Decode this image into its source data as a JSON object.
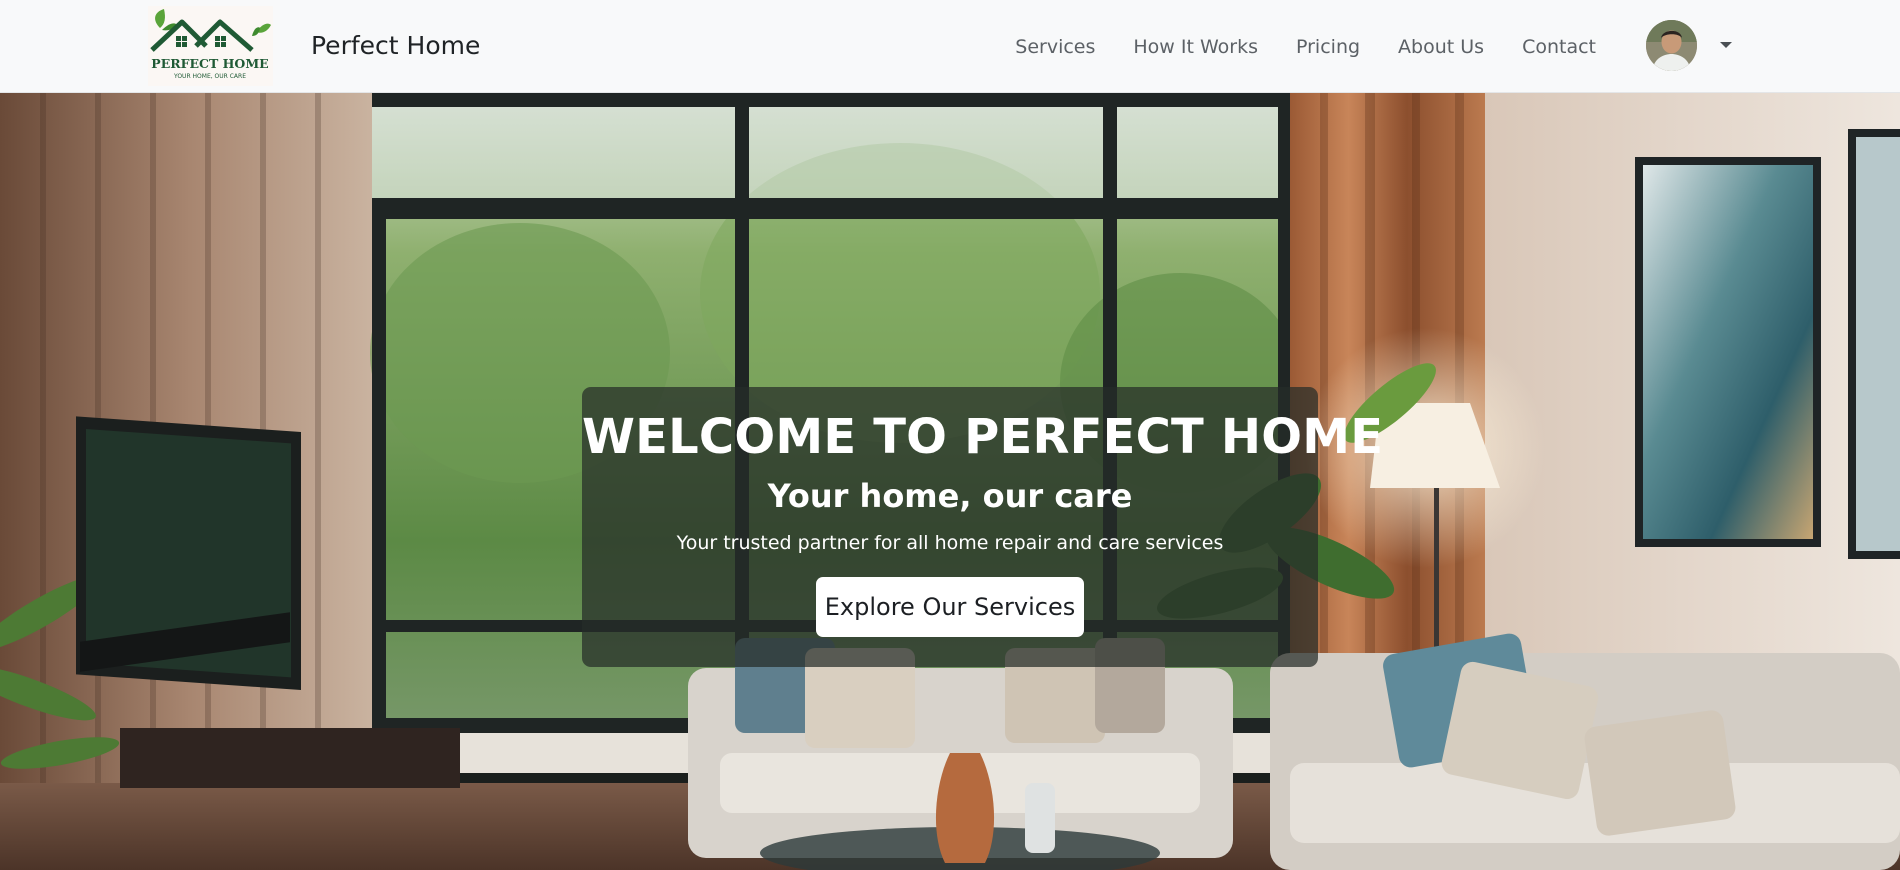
{
  "navbar": {
    "brand_logo_alt": "Perfect Home logo",
    "logo_title": "PERFECT HOME",
    "logo_tagline": "YOUR HOME, OUR CARE",
    "brand_name": "Perfect Home",
    "links": [
      {
        "label": "Services"
      },
      {
        "label": "How It Works"
      },
      {
        "label": "Pricing"
      },
      {
        "label": "About Us"
      },
      {
        "label": "Contact"
      }
    ],
    "avatar_alt": "User profile"
  },
  "hero": {
    "title": "WELCOME TO PERFECT HOME",
    "subtitle": "Your home, our care",
    "tagline": "Your trusted partner for all home repair and care services",
    "cta_label": "Explore Our Services"
  },
  "colors": {
    "navbar_bg": "#f8f9fa",
    "brand_green": "#1f5a35",
    "leaf_green": "#5aa43a",
    "card_overlay": "rgba(38,44,40,0.72)",
    "cta_bg": "#ffffff"
  },
  "icons": {
    "logo": "house-roof-leaves-icon",
    "dropdown": "caret-down-icon"
  }
}
